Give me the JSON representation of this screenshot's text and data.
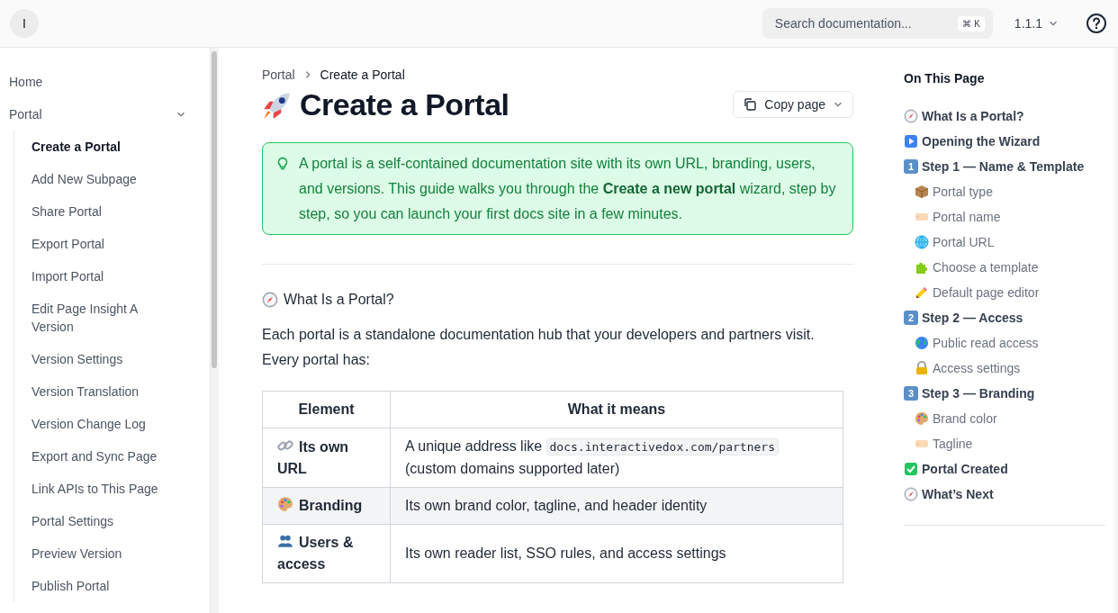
{
  "header": {
    "avatar": "I",
    "search": {
      "placeholder": "Search documentation...",
      "shortcut": "⌘ K"
    },
    "version": "1.1.1"
  },
  "sidebar": {
    "items": [
      {
        "label": "Home",
        "selected": false
      },
      {
        "label": "Portal",
        "selected": false,
        "expanded": true,
        "children": [
          {
            "label": "Create a Portal",
            "selected": true
          },
          {
            "label": "Add New Subpage",
            "selected": false
          },
          {
            "label": "Share Portal",
            "selected": false
          },
          {
            "label": "Export Portal",
            "selected": false
          },
          {
            "label": "Import Portal",
            "selected": false
          },
          {
            "label": "Edit Page Insight A Version",
            "selected": false
          },
          {
            "label": "Version Settings",
            "selected": false
          },
          {
            "label": "Version Translation",
            "selected": false
          },
          {
            "label": "Version Change Log",
            "selected": false
          },
          {
            "label": "Export and Sync Page",
            "selected": false
          },
          {
            "label": "Link APIs to This Page",
            "selected": false
          },
          {
            "label": "Portal Settings",
            "selected": false
          },
          {
            "label": "Preview Version",
            "selected": false
          },
          {
            "label": "Publish Portal",
            "selected": false
          }
        ]
      }
    ]
  },
  "breadcrumb": [
    "Portal",
    "Create a Portal"
  ],
  "title": "Create a Portal",
  "copy_button": "Copy page",
  "callout": "A portal is a self-contained documentation site with its own URL, branding, users, and versions. This guide walks you through the **Create a new portal** wizard, step by step, so you can launch your first docs site in a few minutes.",
  "section_heading": "What Is a Portal?",
  "paragraph": "Each portal is a standalone documentation hub that your developers and partners visit. Every portal has:",
  "table": {
    "columns": [
      "Element",
      "What it means"
    ],
    "rows": [
      {
        "kind": "link",
        "element": "Its own URL",
        "meaning": [
          {
            "kind": "text",
            "text": "A unique address like "
          },
          {
            "kind": "code",
            "text": "docs.interactivedox.com/partners"
          },
          {
            "kind": "text",
            "text": " (custom domains supported later)"
          }
        ]
      },
      {
        "kind": "palette",
        "element": "Branding",
        "meaning": [
          {
            "kind": "text",
            "text": "Its own brand color, tagline, and header identity"
          }
        ]
      },
      {
        "kind": "people",
        "element": "Users & access",
        "meaning": [
          {
            "kind": "text",
            "text": "Its own reader list, SSO rules, and access settings"
          }
        ]
      }
    ]
  },
  "toc": {
    "title": "On This Page",
    "items": [
      {
        "kind": "compass",
        "label": "What Is a Portal?"
      },
      {
        "kind": "play",
        "label": "Opening the Wizard"
      },
      {
        "kind": "keycap",
        "badge": "1",
        "label": "Step 1 — Name & Template",
        "children": [
          {
            "kind": "box",
            "label": "Portal type"
          },
          {
            "kind": "tag",
            "label": "Portal name"
          },
          {
            "kind": "globe",
            "label": "Portal URL"
          },
          {
            "kind": "puzzle",
            "label": "Choose a template"
          },
          {
            "kind": "pencil",
            "label": "Default page editor"
          }
        ]
      },
      {
        "kind": "keycap",
        "badge": "2",
        "label": "Step 2 — Access",
        "children": [
          {
            "kind": "earth",
            "label": "Public read access"
          },
          {
            "kind": "lock",
            "label": "Access settings"
          }
        ]
      },
      {
        "kind": "keycap",
        "badge": "3",
        "label": "Step 3 — Branding",
        "children": [
          {
            "kind": "palette",
            "label": "Brand color"
          },
          {
            "kind": "tag",
            "label": "Tagline"
          }
        ]
      },
      {
        "kind": "check",
        "label": "Portal Created"
      },
      {
        "kind": "compass",
        "label": "What’s Next"
      }
    ]
  }
}
